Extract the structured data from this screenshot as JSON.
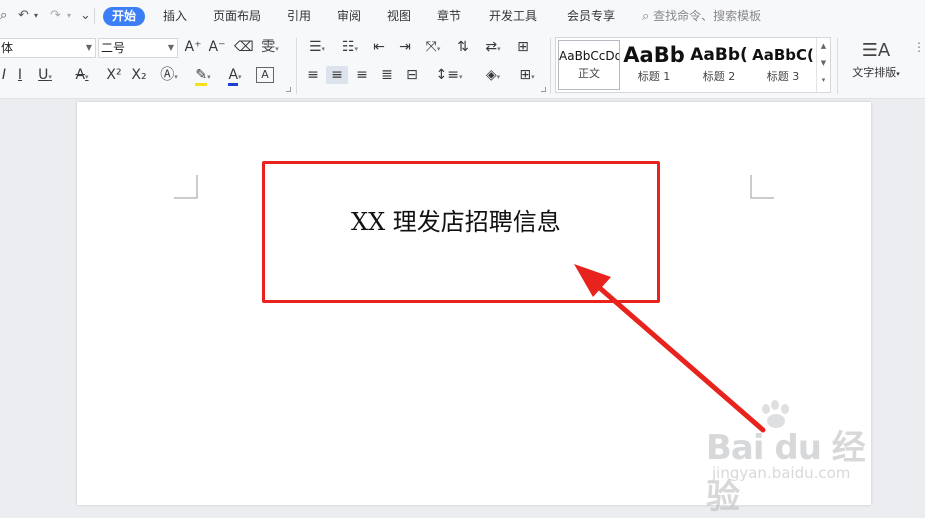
{
  "menubar": {
    "quick_access": [
      "⎙",
      "↶",
      "▾",
      "↷",
      "▾",
      "⌄"
    ],
    "tabs": [
      {
        "label": "开始",
        "active": true
      },
      {
        "label": "插入"
      },
      {
        "label": "页面布局"
      },
      {
        "label": "引用"
      },
      {
        "label": "审阅"
      },
      {
        "label": "视图"
      },
      {
        "label": "章节"
      },
      {
        "label": "开发工具"
      },
      {
        "label": "会员专享"
      }
    ],
    "search_placeholder": "查找命令、搜索模板"
  },
  "ribbon": {
    "font_family": "体",
    "font_size": "二号",
    "style_gallery": [
      {
        "sample": "AaBbCcDd",
        "name": "正文",
        "selected": true
      },
      {
        "sample": "AaBb",
        "name": "标题 1"
      },
      {
        "sample": "AaBb(",
        "name": "标题 2"
      },
      {
        "sample": "AaBbC(",
        "name": "标题 3"
      }
    ],
    "text_layout_label": "文字排版",
    "accent_color": "#3b7ef6",
    "highlight_color": "#f5e11a",
    "font_color": "#1a3fd1"
  },
  "document": {
    "title_text": "XX 理发店招聘信息",
    "annotation_color": "#e8221c"
  },
  "watermark": {
    "logo_text": "Bai du 经验",
    "url_text": "jingyan.baidu.com"
  }
}
